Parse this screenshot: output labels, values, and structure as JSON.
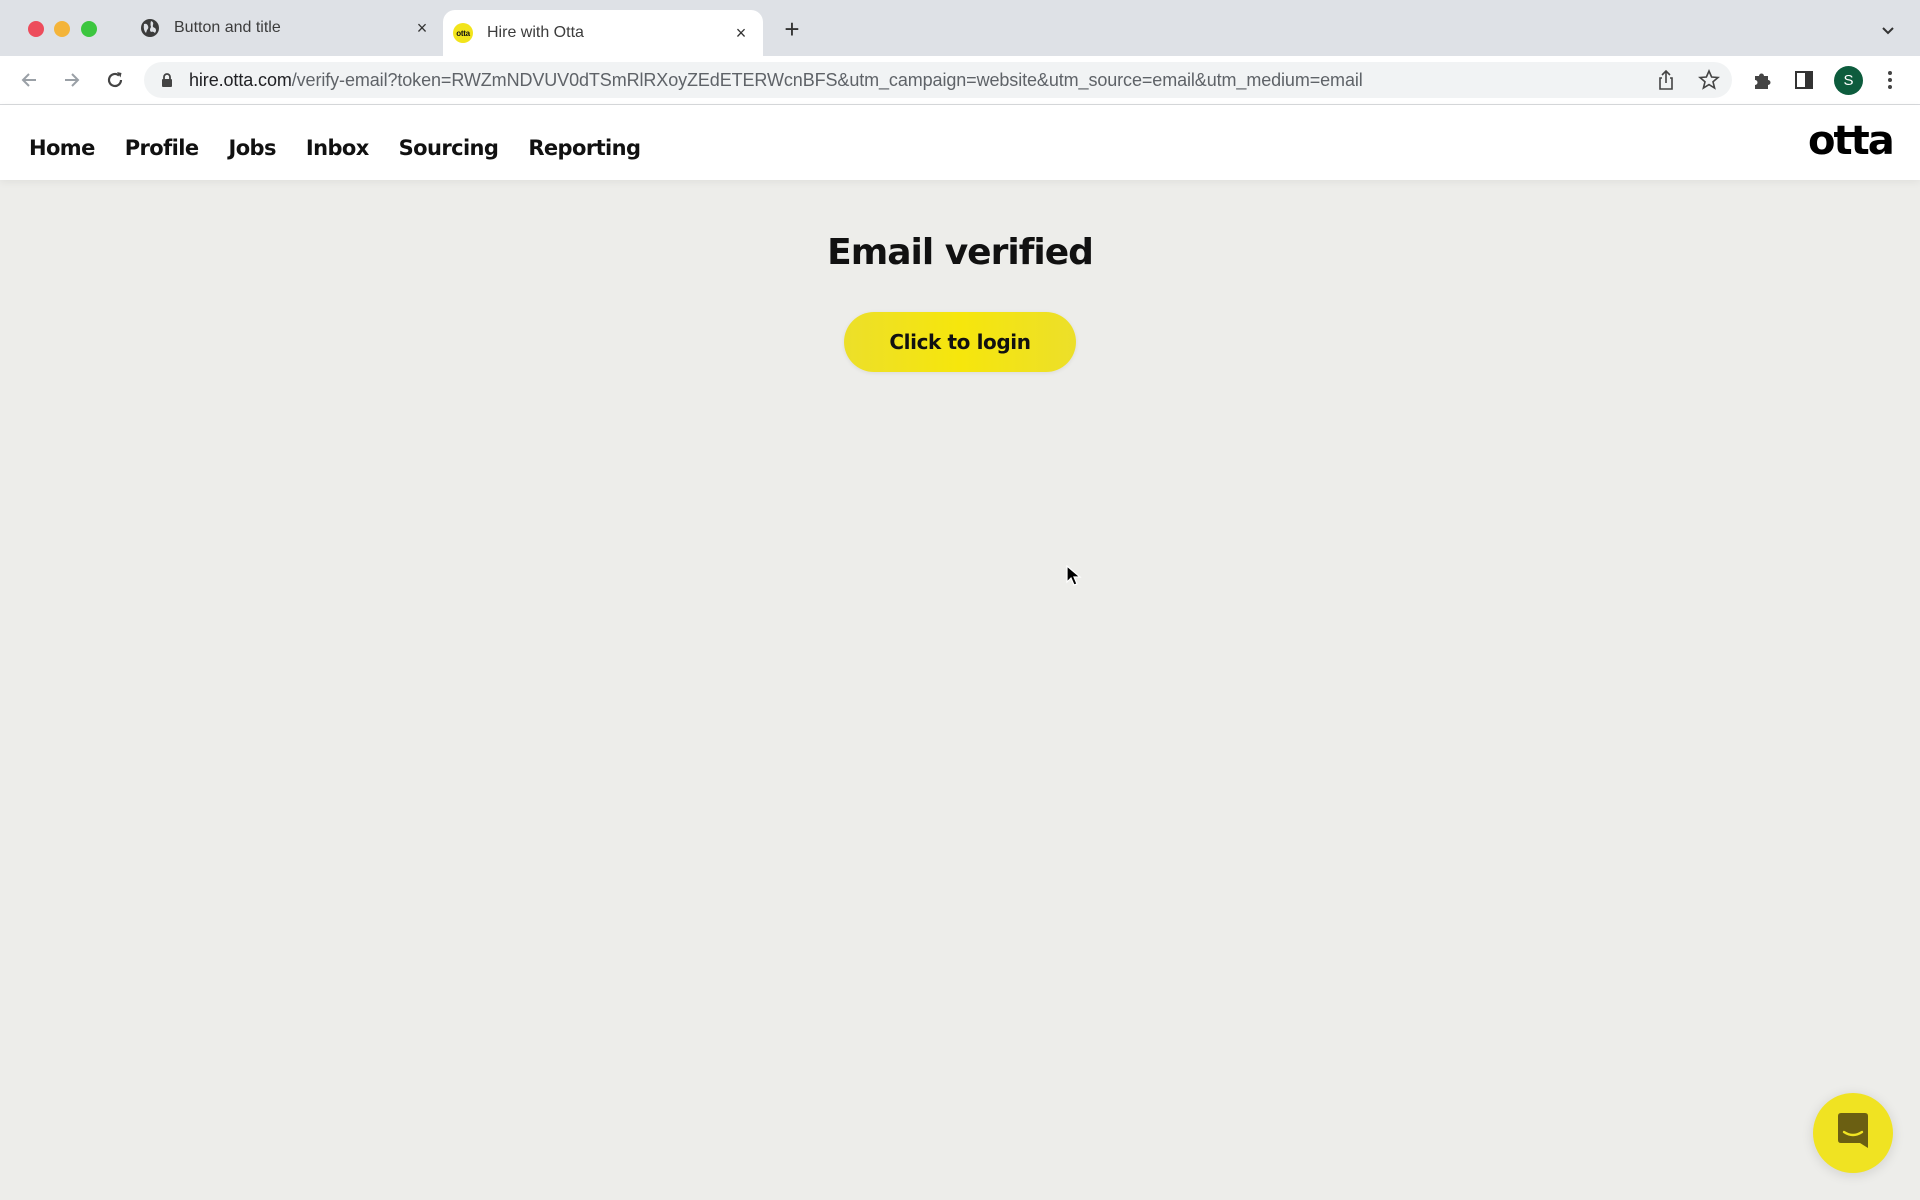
{
  "browser": {
    "tabs": [
      {
        "title": "Button and title",
        "icon": "globe-icon",
        "active": false
      },
      {
        "title": "Hire with Otta",
        "icon": "otta-favicon",
        "favicon_text": "otta",
        "active": true
      }
    ],
    "new_tab_label": "+",
    "close_glyph": "×",
    "url_host": "hire.otta.com",
    "url_path": "/verify-email?token=RWZmNDVUV0dTSmRlRXoyZEdETERWcnBFS&utm_campaign=website&utm_source=email&utm_medium=email",
    "profile_initial": "S"
  },
  "header": {
    "nav": [
      "Home",
      "Profile",
      "Jobs",
      "Inbox",
      "Sourcing",
      "Reporting"
    ],
    "logo": "otta"
  },
  "main": {
    "title": "Email verified",
    "login_button": "Click to login"
  },
  "colors": {
    "accent_yellow": "#f2e41b",
    "background": "#ededea",
    "avatar_green": "#0d5c3d"
  }
}
